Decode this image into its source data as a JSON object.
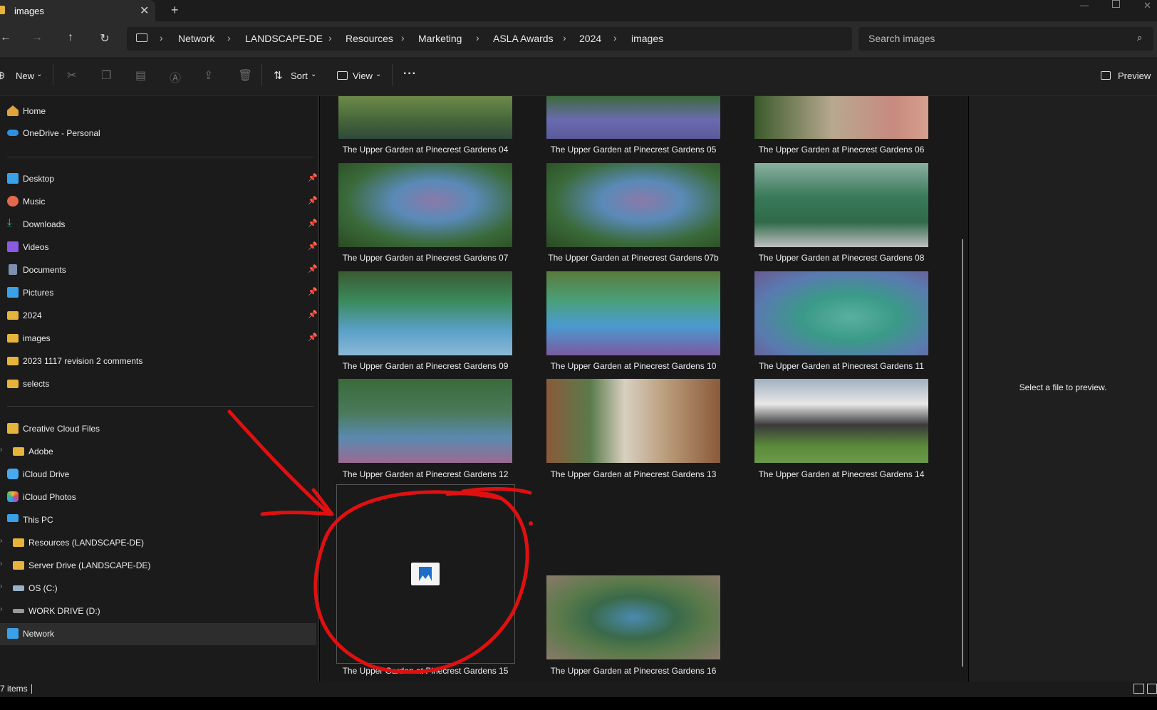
{
  "tab": {
    "title": "images"
  },
  "breadcrumbs": [
    "Network",
    "LANDSCAPE-DE",
    "Resources",
    "Marketing",
    "ASLA Awards",
    "2024",
    "images"
  ],
  "search": {
    "placeholder": "Search images"
  },
  "toolbar": {
    "new_label": "New",
    "sort_label": "Sort",
    "view_label": "View",
    "more_label": "···",
    "preview_label": "Preview"
  },
  "sidebar": {
    "quick": [
      {
        "label": "Home",
        "icon": "home-icon"
      },
      {
        "label": "OneDrive - Personal",
        "icon": "onedrive-icon"
      }
    ],
    "pinned": [
      {
        "label": "Desktop",
        "icon": "desktop-icon",
        "pinned": true
      },
      {
        "label": "Music",
        "icon": "music-icon",
        "pinned": true
      },
      {
        "label": "Downloads",
        "icon": "downloads-icon",
        "pinned": true
      },
      {
        "label": "Videos",
        "icon": "videos-icon",
        "pinned": true
      },
      {
        "label": "Documents",
        "icon": "documents-icon",
        "pinned": true
      },
      {
        "label": "Pictures",
        "icon": "pictures-icon",
        "pinned": true
      },
      {
        "label": "2024",
        "icon": "folder-icon",
        "pinned": true
      },
      {
        "label": "images",
        "icon": "folder-icon",
        "pinned": true
      },
      {
        "label": "2023 1117 revision 2 comments",
        "icon": "folder-icon",
        "pinned": false
      },
      {
        "label": "selects",
        "icon": "folder-icon",
        "pinned": false
      }
    ],
    "drives": [
      {
        "label": "Creative Cloud Files",
        "icon": "creative-cloud-icon"
      },
      {
        "label": "Adobe",
        "icon": "folder-icon"
      },
      {
        "label": "iCloud Drive",
        "icon": "icloud-drive-icon"
      },
      {
        "label": "iCloud Photos",
        "icon": "icloud-photos-icon"
      },
      {
        "label": "This PC",
        "icon": "this-pc-icon"
      },
      {
        "label": "Resources (LANDSCAPE-DE)",
        "icon": "network-folder-icon"
      },
      {
        "label": "Server Drive (LANDSCAPE-DE)",
        "icon": "network-folder-icon"
      },
      {
        "label": "OS (C:)",
        "icon": "drive-icon"
      },
      {
        "label": "WORK DRIVE (D:)",
        "icon": "drive-icon"
      },
      {
        "label": "Network",
        "icon": "network-icon"
      }
    ]
  },
  "files": [
    {
      "name": "The Upper Garden at Pinecrest Gardens 04"
    },
    {
      "name": "The Upper Garden at Pinecrest Gardens 05"
    },
    {
      "name": "The Upper Garden at Pinecrest Gardens 06"
    },
    {
      "name": "The Upper Garden at Pinecrest Gardens 07"
    },
    {
      "name": "The Upper Garden at Pinecrest Gardens 07b"
    },
    {
      "name": "The Upper Garden at Pinecrest Gardens 08"
    },
    {
      "name": "The Upper Garden at Pinecrest Gardens 09"
    },
    {
      "name": "The Upper Garden at Pinecrest Gardens 10"
    },
    {
      "name": "The Upper Garden at Pinecrest Gardens 11"
    },
    {
      "name": "The Upper Garden at Pinecrest Gardens 12"
    },
    {
      "name": "The Upper Garden at Pinecrest Gardens 13"
    },
    {
      "name": "The Upper Garden at Pinecrest Gardens 14"
    },
    {
      "name": "The Upper Garden at Pinecrest Gardens 15",
      "placeholder_thumbnail": true
    },
    {
      "name": "The Upper Garden at Pinecrest Gardens 16"
    }
  ],
  "preview_pane": {
    "message": "Select a file to preview."
  },
  "status": {
    "items": "7 items"
  },
  "colors": {
    "annotation": "#e01010",
    "folder": "#e8b33a",
    "accent": "#3b8fe0"
  }
}
